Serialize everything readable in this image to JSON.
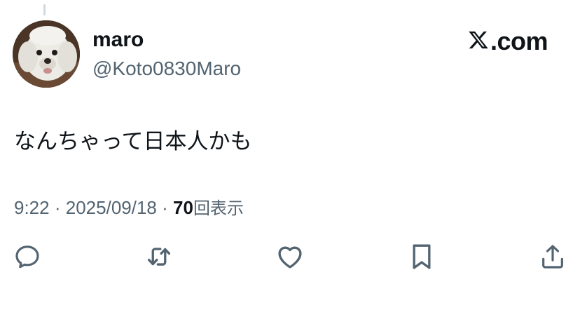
{
  "author": {
    "display_name": "maro",
    "handle": "@Koto0830Maro",
    "avatar_icon": "dog-avatar"
  },
  "brand": {
    "logo_icon": "x-logo-icon",
    "text": ".com"
  },
  "tweet": {
    "text": "なんちゃって日本人かも"
  },
  "meta": {
    "time": "9:22",
    "separator": "·",
    "date": "2025/09/18",
    "views_count": "70",
    "views_label": "回表示"
  },
  "actions": [
    {
      "name": "reply",
      "icon": "comment-icon"
    },
    {
      "name": "repost",
      "icon": "repost-icon"
    },
    {
      "name": "like",
      "icon": "heart-icon"
    },
    {
      "name": "bookmark",
      "icon": "bookmark-icon"
    },
    {
      "name": "share",
      "icon": "share-icon"
    }
  ],
  "colors": {
    "text_primary": "#0f1419",
    "text_secondary": "#536471",
    "icon": "#536471",
    "background": "#ffffff"
  }
}
